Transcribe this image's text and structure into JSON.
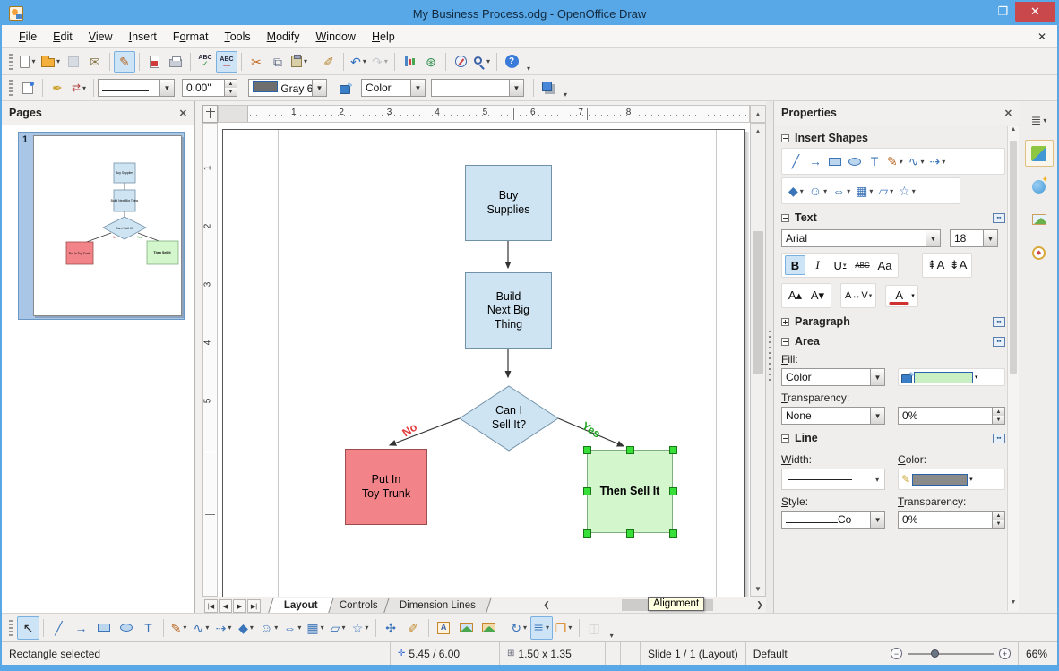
{
  "window": {
    "title": "My Business Process.odg - OpenOffice Draw",
    "controls": {
      "minimize": "–",
      "maximize": "❒",
      "close": "✕"
    }
  },
  "menu": {
    "close_doc": "✕",
    "items": [
      {
        "label": "File",
        "u": 0
      },
      {
        "label": "Edit",
        "u": 0
      },
      {
        "label": "View",
        "u": 0
      },
      {
        "label": "Insert",
        "u": 0
      },
      {
        "label": "Format",
        "u": 1
      },
      {
        "label": "Tools",
        "u": 0
      },
      {
        "label": "Modify",
        "u": 0
      },
      {
        "label": "Window",
        "u": 0
      },
      {
        "label": "Help",
        "u": 0
      }
    ]
  },
  "toolbar_main": {
    "buttons": [
      {
        "name": "new-document-button",
        "css": "ic-page",
        "dd": true
      },
      {
        "name": "open-button",
        "css": "ic-folder",
        "dd": true
      },
      {
        "name": "save-button",
        "css": "ic-floppy",
        "disabled": true
      },
      {
        "name": "email-document-button",
        "glyph": "✉",
        "color": "#8a7a4a"
      },
      {
        "sep": true
      },
      {
        "name": "edit-file-button",
        "glyph": "✎",
        "color": "#b8651f",
        "active": true
      },
      {
        "sep": true
      },
      {
        "name": "export-pdf-button",
        "css": "ic-pdf"
      },
      {
        "name": "print-button",
        "css": "ic-print"
      },
      {
        "sep": true
      },
      {
        "name": "spellcheck-button",
        "css": "ic-spell"
      },
      {
        "name": "autospellcheck-button",
        "css": "ic-autospell",
        "active": true
      },
      {
        "sep": true
      },
      {
        "name": "cut-button",
        "glyph": "✂",
        "color": "#c26a1e"
      },
      {
        "name": "copy-button",
        "glyph": "⧉",
        "color": "#55617a"
      },
      {
        "name": "paste-button",
        "css": "ic-clip",
        "dd": true
      },
      {
        "sep": true
      },
      {
        "name": "format-paintbrush-button",
        "glyph": "✐",
        "color": "#b5832a"
      },
      {
        "sep": true
      },
      {
        "name": "undo-button",
        "glyph": "↶",
        "color": "#2d6fc0",
        "dd": true
      },
      {
        "name": "redo-button",
        "glyph": "↷",
        "color": "#9aa0a8",
        "disabled": true,
        "dd": true
      },
      {
        "sep": true
      },
      {
        "name": "insert-chart-button",
        "css": "ic-chart"
      },
      {
        "name": "hyperlink-button",
        "glyph": "⊛",
        "color": "#2f8f4e"
      },
      {
        "sep": true
      },
      {
        "name": "navigator-button",
        "css": "ic-compass"
      },
      {
        "name": "zoom-button",
        "css": "ic-zoom",
        "dd": true
      },
      {
        "sep": true
      },
      {
        "name": "help-button",
        "css": "ic-help"
      }
    ]
  },
  "toolbar_line_fill": {
    "line_width_value": "0.00\"",
    "line_color_value": "Gray 6",
    "line_color_swatch": "#6e6e6e",
    "fill_type_value": "Color",
    "fill_color_value": ""
  },
  "pages_panel": {
    "title": "Pages",
    "close": "✕",
    "page_number": "1"
  },
  "rulers": {
    "h_numbers": [
      "1",
      "2",
      "3",
      "4",
      "5",
      "6",
      "7",
      "8"
    ],
    "v_numbers": [
      "1",
      "2",
      "3",
      "4",
      "5"
    ]
  },
  "canvas": {
    "shapes": {
      "buy_supplies": {
        "label": "Buy\nSupplies"
      },
      "build_next": {
        "label": "Build\nNext Big\nThing"
      },
      "decision": {
        "label": "Can I\nSell It?"
      },
      "no_branch": {
        "label": "No"
      },
      "yes_branch": {
        "label": "Yes"
      },
      "put_in_toy_trunk": {
        "label": "Put In\nToy Trunk"
      },
      "then_sell_it": {
        "label": "Then Sell It"
      }
    },
    "colors": {
      "process_fill": "#cfe4f2",
      "process_border": "#7191a9",
      "no_fill": "#f28489",
      "no_border": "#9b4d4d",
      "yes_fill": "#d4f6cd",
      "yes_border": "#7fae7f",
      "no_label": "#e03c3c",
      "yes_label": "#1fa421",
      "handle_fill": "#38df38",
      "handle_border": "#157a15",
      "connector": "#333333"
    }
  },
  "tabs": {
    "items": [
      "Layout",
      "Controls",
      "Dimension Lines"
    ],
    "active": "Layout"
  },
  "sidebar": {
    "title": "Properties",
    "close": "✕",
    "sections": {
      "insert_shapes": "Insert Shapes",
      "text": "Text",
      "paragraph": "Paragraph",
      "area": "Area",
      "line": "Line"
    },
    "insert_row1": [
      {
        "name": "insert-line-button",
        "glyph": "╱",
        "color": "#3b74b8"
      },
      {
        "name": "insert-line-arrow-button",
        "glyph": "→",
        "color": "#3b74b8"
      },
      {
        "name": "insert-rectangle-button",
        "css": "ic-rect"
      },
      {
        "name": "insert-ellipse-button",
        "css": "ic-ellipse"
      },
      {
        "name": "insert-text-button",
        "glyph": "T",
        "color": "#3b74b8"
      },
      {
        "name": "insert-curve-button",
        "glyph": "✎",
        "color": "#b8651f",
        "dd": true
      },
      {
        "name": "insert-connector-button",
        "glyph": "∿",
        "color": "#3b74b8",
        "dd": true
      },
      {
        "name": "insert-lines-arrows-button",
        "glyph": "⇢",
        "color": "#3b74b8",
        "dd": true
      }
    ],
    "insert_row2": [
      {
        "name": "basic-shapes-button",
        "glyph": "◆",
        "color": "#3b74b8",
        "dd": true
      },
      {
        "name": "symbol-shapes-button",
        "glyph": "☺",
        "color": "#3b74b8",
        "dd": true
      },
      {
        "name": "block-arrows-button",
        "glyph": "⇔",
        "color": "#3b74b8",
        "dd": true
      },
      {
        "name": "flowchart-button",
        "glyph": "▦",
        "color": "#3b74b8",
        "dd": true
      },
      {
        "name": "callouts-button",
        "glyph": "▱",
        "color": "#3b74b8",
        "dd": true
      },
      {
        "name": "stars-button",
        "glyph": "☆",
        "color": "#3b74b8",
        "dd": true
      }
    ],
    "text": {
      "font_name": "Arial",
      "font_size": "18",
      "bold": "B",
      "italic": "I",
      "underline": "U",
      "strike": "ABC",
      "case": "Aa"
    },
    "area": {
      "fill_label": "Fill:",
      "fill_type": "Color",
      "fill_swatch": "#c9efc2",
      "transparency_label": "Transparency:",
      "transparency_type": "None",
      "transparency_value": "0%"
    },
    "line": {
      "width_label": "Width:",
      "color_label": "Color:",
      "color_swatch": "#8a8a8a",
      "style_label": "Style:",
      "style_value": "Co",
      "transparency_label": "Transparency:",
      "transparency_value": "0%"
    }
  },
  "tab_strip": {
    "buttons": [
      {
        "name": "sidebar-menu-button",
        "glyph": "≣",
        "color": "#444",
        "dd": true
      },
      {
        "name": "properties-tab",
        "css": "ic-cube",
        "active": true
      },
      {
        "name": "gallery-tab",
        "css": "ic-gallery"
      },
      {
        "name": "styles-tab",
        "css": "ic-photos"
      },
      {
        "name": "navigator-tab",
        "css": "ic-compass2"
      }
    ]
  },
  "drawbar": {
    "buttons": [
      {
        "name": "select-button",
        "glyph": "↖",
        "color": "#222",
        "active": true
      },
      {
        "sep": true
      },
      {
        "name": "line-button",
        "glyph": "╱",
        "color": "#3b74b8"
      },
      {
        "name": "line-arrow-button",
        "glyph": "→",
        "color": "#3b74b8"
      },
      {
        "name": "rectangle-button",
        "css": "ic-rect"
      },
      {
        "name": "ellipse-button",
        "css": "ic-ellipse"
      },
      {
        "name": "text-button",
        "glyph": "T",
        "color": "#3b74b8"
      },
      {
        "sep": true
      },
      {
        "name": "curve-button",
        "glyph": "✎",
        "color": "#b8651f",
        "dd": true
      },
      {
        "name": "connector-button",
        "glyph": "∿",
        "color": "#3b74b8",
        "dd": true
      },
      {
        "name": "lines-arrows-button",
        "glyph": "⇢",
        "color": "#3b74b8",
        "dd": true
      },
      {
        "name": "basic-shapes-button",
        "glyph": "◆",
        "color": "#3b74b8",
        "dd": true
      },
      {
        "name": "symbol-shapes-button",
        "glyph": "☺",
        "color": "#3b74b8",
        "dd": true
      },
      {
        "name": "block-arrows-button",
        "glyph": "⇔",
        "color": "#3b74b8",
        "dd": true
      },
      {
        "name": "flowchart-button",
        "glyph": "▦",
        "color": "#3b74b8",
        "dd": true
      },
      {
        "name": "callouts-button",
        "glyph": "▱",
        "color": "#3b74b8",
        "dd": true
      },
      {
        "name": "stars-button",
        "glyph": "☆",
        "color": "#3b74b8",
        "dd": true
      },
      {
        "sep": true
      },
      {
        "name": "edit-points-button",
        "glyph": "✣",
        "color": "#3b74b8"
      },
      {
        "name": "glue-points-button",
        "glyph": "✐",
        "color": "#c08a2d"
      },
      {
        "sep": true
      },
      {
        "name": "fontwork-button",
        "css": "ic-fontwork"
      },
      {
        "name": "from-file-button",
        "css": "ic-picture"
      },
      {
        "name": "gallery-button",
        "css": "ic-picture2"
      },
      {
        "sep": true
      },
      {
        "name": "rotate-button",
        "glyph": "↻",
        "color": "#3b74b8",
        "dd": true
      },
      {
        "name": "alignment-button",
        "glyph": "≣",
        "color": "#3b74b8",
        "active": true,
        "dd": true
      },
      {
        "name": "arrange-button",
        "glyph": "❐",
        "color": "#d98a2b",
        "dd": true
      },
      {
        "sep": true
      },
      {
        "name": "3d-controller-button",
        "glyph": "◫",
        "color": "#aaa",
        "disabled": true
      }
    ]
  },
  "statusbar": {
    "selection": "Rectangle selected",
    "position": "5.45 / 6.00",
    "size": "1.50 x 1.35",
    "slide": "Slide 1 / 1 (Layout)",
    "style": "Default",
    "zoom": "66%"
  },
  "tooltip": {
    "text": "Alignment"
  }
}
